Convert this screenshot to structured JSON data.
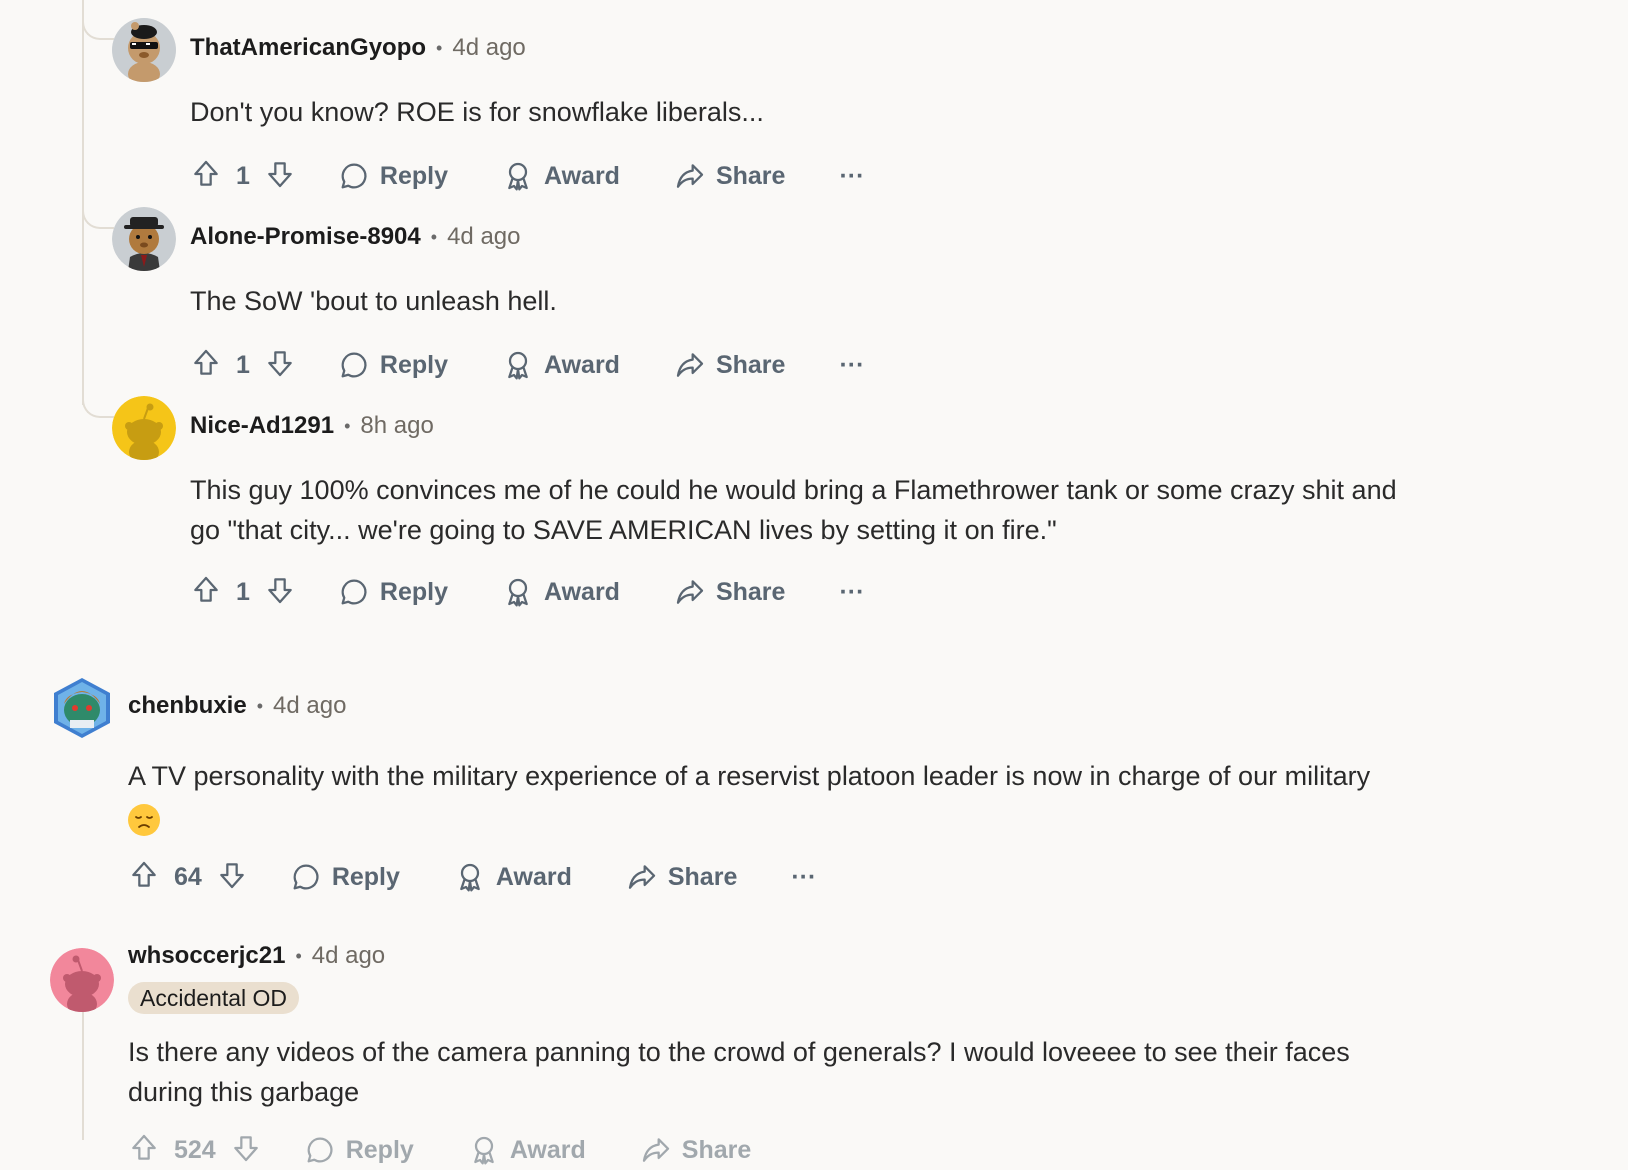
{
  "comments": [
    {
      "author": "ThatAmericanGyopo",
      "time": "4d ago",
      "text": "Don't you know? ROE is for snowflake liberals...",
      "score": "1",
      "reply": "Reply",
      "award": "Award",
      "share": "Share",
      "more": "···"
    },
    {
      "author": "Alone-Promise-8904",
      "time": "4d ago",
      "text": "The SoW 'bout to unleash hell.",
      "score": "1",
      "reply": "Reply",
      "award": "Award",
      "share": "Share",
      "more": "···"
    },
    {
      "author": "Nice-Ad1291",
      "time": "8h ago",
      "text_line1": "This guy 100% convinces me of he could he would bring a Flamethrower tank or some crazy shit and",
      "text_line2": "go \"that city... we're going to SAVE AMERICAN lives by setting it on fire.\"",
      "score": "1",
      "reply": "Reply",
      "award": "Award",
      "share": "Share",
      "more": "···"
    },
    {
      "author": "chenbuxie",
      "time": "4d ago",
      "text": "A TV personality with the military experience of a reservist platoon leader is now in charge of our military",
      "emoji": "disappointed-face",
      "score": "64",
      "reply": "Reply",
      "award": "Award",
      "share": "Share",
      "more": "···"
    },
    {
      "author": "whsoccerjc21",
      "time": "4d ago",
      "flair": "Accidental OD",
      "text_line1": "Is there any videos of the camera panning to the crowd of generals? I would loveeee to see their faces",
      "text_line2": "during this garbage",
      "score": "524",
      "reply": "Reply",
      "award": "Award",
      "share": "Share"
    }
  ],
  "colors": {
    "background": "#faf9f7",
    "thread": "#e2ddd4",
    "action": "#5a6672",
    "flair": "#eadfcf"
  },
  "icons": [
    "upvote-icon",
    "downvote-icon",
    "comment-bubble-icon",
    "award-icon",
    "share-arrow-icon",
    "more-icon"
  ]
}
